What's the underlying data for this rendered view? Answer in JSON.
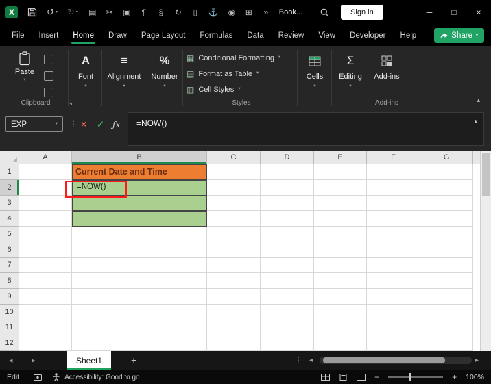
{
  "titlebar": {
    "app_icon_letter": "X",
    "workbook_name": "Book...",
    "sign_in_label": "Sign in",
    "undo": {
      "glyph": "↺"
    },
    "redo": {
      "glyph": "↻"
    },
    "qat_icons": [
      {
        "name": "copy",
        "glyph": "▤"
      },
      {
        "name": "cut",
        "glyph": "✂"
      },
      {
        "name": "picture",
        "glyph": "▣"
      },
      {
        "name": "paragraph-marks",
        "glyph": "¶"
      },
      {
        "name": "styles",
        "glyph": "§"
      },
      {
        "name": "refresh",
        "glyph": "↻"
      },
      {
        "name": "document",
        "glyph": "▯"
      },
      {
        "name": "anchor",
        "glyph": "⚓"
      },
      {
        "name": "camera",
        "glyph": "◉"
      },
      {
        "name": "table",
        "glyph": "⊞"
      },
      {
        "name": "overflow",
        "glyph": "»"
      }
    ],
    "window_controls": {
      "minimize": "─",
      "maximize": "□",
      "close": "×"
    }
  },
  "menubar": {
    "items": [
      "File",
      "Insert",
      "Home",
      "Draw",
      "Page Layout",
      "Formulas",
      "Data",
      "Review",
      "View",
      "Developer",
      "Help"
    ],
    "active_item": "Home",
    "share_label": "Share"
  },
  "ribbon": {
    "paste": {
      "label": "Paste"
    },
    "clipboard_group_label": "Clipboard",
    "dialog_launcher_glyph": "↘",
    "font_group": {
      "label": "Font",
      "icon": "A"
    },
    "alignment_group": {
      "label": "Alignment",
      "icon": "≡"
    },
    "number_group": {
      "label": "Number",
      "icon": "%"
    },
    "styles_group": {
      "label": "Styles",
      "items": [
        {
          "label": "Conditional Formatting",
          "glyph": "▦"
        },
        {
          "label": "Format as Table",
          "glyph": "▤"
        },
        {
          "label": "Cell Styles",
          "glyph": "▥"
        }
      ]
    },
    "cells_group": {
      "label": "Cells"
    },
    "editing_group": {
      "label": "Editing",
      "icon": "Σ"
    },
    "addins_group": {
      "button_label": "Add-ins",
      "group_label": "Add-ins"
    },
    "dropdown_glyph": "▾",
    "collapse_glyph": "▴"
  },
  "formula_bar": {
    "name_box": "EXP",
    "cancel": "×",
    "enter": "✓",
    "fx": "ƒx",
    "formula": "=NOW()"
  },
  "grid": {
    "columns": [
      "A",
      "B",
      "C",
      "D",
      "E",
      "F",
      "G"
    ],
    "rows": [
      "1",
      "2",
      "3",
      "4",
      "5",
      "6",
      "7",
      "8",
      "9",
      "10",
      "11",
      "12"
    ],
    "cells": {
      "B1": "Current Date and Time",
      "B2": "=NOW()"
    },
    "cell_styles": {
      "B1": "c-orange",
      "B2": "c-green",
      "B3": "c-green",
      "B4": "c-green"
    },
    "selected_column": "B",
    "selected_row": "2"
  },
  "sheet_tabs": {
    "active_tab": "Sheet1",
    "add_label": "+",
    "nav_left": "◂",
    "nav_right": "▸",
    "menu_dots": "⋮"
  },
  "status_bar": {
    "mode": "Edit",
    "accessibility_text": "Accessibility: Good to go",
    "zoom_out": "−",
    "zoom_in": "+",
    "zoom_level": "100%"
  },
  "colors": {
    "accent_green": "#21A366",
    "cell_orange": "#ED7D31",
    "cell_green": "#A9D08E",
    "highlight_red": "#FF1A1A"
  }
}
